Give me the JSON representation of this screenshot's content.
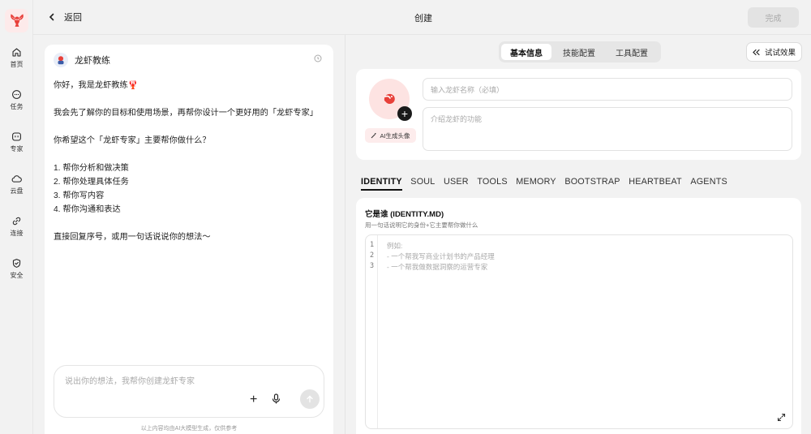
{
  "topbar": {
    "back_label": "返回",
    "title": "创建",
    "done_label": "完成"
  },
  "nav": [
    {
      "label": "首页",
      "icon": "home-icon"
    },
    {
      "label": "任务",
      "icon": "chat-icon"
    },
    {
      "label": "专家",
      "icon": "expert-icon"
    },
    {
      "label": "云盘",
      "icon": "cloud-icon"
    },
    {
      "label": "连接",
      "icon": "link-icon"
    },
    {
      "label": "安全",
      "icon": "shield-icon"
    }
  ],
  "chat": {
    "bot_name": "龙虾教练",
    "lines": [
      "你好，我是龙虾教练🦞",
      "",
      "我会先了解你的目标和使用场景，再帮你设计一个更好用的「龙虾专家」",
      "",
      "你希望这个「龙虾专家」主要帮你做什么？",
      "",
      "1. 帮你分析和做决策",
      "2. 帮你处理具体任务",
      "3. 帮你写内容",
      "4. 帮你沟通和表达",
      "",
      "直接回复序号，或用一句话说说你的想法～"
    ],
    "input_placeholder": "说出你的想法，我帮你创建龙虾专家",
    "disclaimer": "以上内容均由AI大模型生成，仅供参考"
  },
  "config_tabs": [
    {
      "label": "基本信息",
      "active": true
    },
    {
      "label": "技能配置",
      "active": false
    },
    {
      "label": "工具配置",
      "active": false
    }
  ],
  "try_label": "试试效果",
  "basic": {
    "ai_avatar_label": "AI生成头像",
    "name_placeholder": "输入龙虾名称（必填）",
    "desc_placeholder": "介绍龙虾的功能"
  },
  "file_tabs": [
    {
      "label": "IDENTITY",
      "active": true
    },
    {
      "label": "SOUL",
      "active": false
    },
    {
      "label": "USER",
      "active": false
    },
    {
      "label": "TOOLS",
      "active": false
    },
    {
      "label": "MEMORY",
      "active": false
    },
    {
      "label": "BOOTSTRAP",
      "active": false
    },
    {
      "label": "HEARTBEAT",
      "active": false
    },
    {
      "label": "AGENTS",
      "active": false
    }
  ],
  "identity": {
    "title": "它是谁 (IDENTITY.MD)",
    "subtitle": "用一句话说明它的身份+它主要帮你做什么",
    "lines": [
      {
        "num": "1",
        "text": "例如:"
      },
      {
        "num": "2",
        "text": "- 一个帮我写商业计划书的产品经理"
      },
      {
        "num": "3",
        "text": "- 一个帮我做数据洞察的运营专家"
      }
    ]
  },
  "colors": {
    "accent": "#e8403a",
    "bg": "#f2f2f2",
    "card": "#ffffff"
  }
}
